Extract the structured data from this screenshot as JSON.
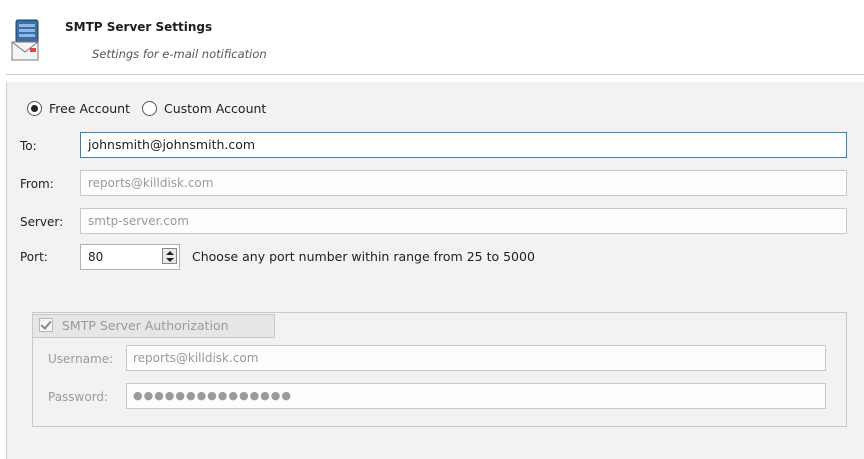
{
  "header": {
    "icon": "server-mail-icon",
    "title": "SMTP Server Settings",
    "subtitle": "Settings for e-mail notification"
  },
  "account_type": {
    "options": [
      {
        "label": "Free Account",
        "selected": true
      },
      {
        "label": "Custom Account",
        "selected": false
      }
    ]
  },
  "fields": {
    "to": {
      "label": "To:",
      "value": "johnsmith@johnsmith.com"
    },
    "from": {
      "label": "From:",
      "placeholder": "reports@killdisk.com"
    },
    "server": {
      "label": "Server:",
      "placeholder": "smtp-server.com"
    },
    "port": {
      "label": "Port:",
      "value": "80",
      "hint": "Choose any port number within range from 25 to 5000"
    }
  },
  "authorization": {
    "label": "SMTP Server Authorization",
    "checked": true,
    "enabled": false,
    "username": {
      "label": "Username:",
      "value": "reports@killdisk.com"
    },
    "password": {
      "label": "Password:",
      "masked": "●●●●●●●●●●●●●●●"
    }
  },
  "colors": {
    "active_border": "#3c7fb1",
    "disabled_text": "#9a9a9a",
    "panel_bg": "#f2f2f2"
  }
}
